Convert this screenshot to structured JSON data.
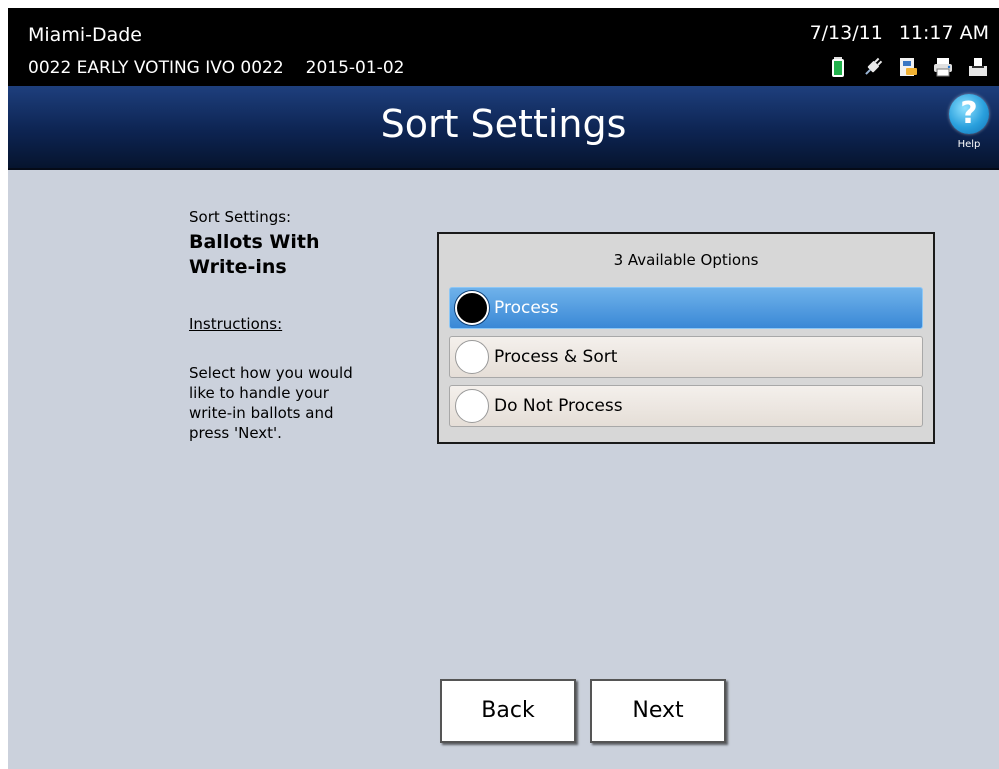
{
  "status": {
    "county": "Miami-Dade",
    "machine_id": "0022 EARLY VOTING IVO 0022",
    "election_date": "2015-01-02",
    "date": "7/13/11",
    "time": "11:17 AM",
    "icons": [
      "battery-icon",
      "power-plug-icon",
      "memory-card-icon",
      "printer-icon",
      "ballot-box-icon"
    ]
  },
  "header": {
    "title": "Sort Settings",
    "help_label": "Help",
    "help_glyph": "?"
  },
  "instructions": {
    "sort_label": "Sort Settings:",
    "setting_name_line1": "Ballots With",
    "setting_name_line2": "Write-ins",
    "instructions_label": "Instructions:",
    "text": "Select how you would like to handle your write-in ballots and press 'Next'."
  },
  "options": {
    "header": "3 Available Options",
    "items": [
      {
        "label": "Process",
        "selected": true
      },
      {
        "label": "Process & Sort",
        "selected": false
      },
      {
        "label": "Do Not Process",
        "selected": false
      }
    ]
  },
  "nav": {
    "back_label": "Back",
    "next_label": "Next"
  },
  "colors": {
    "background": "#cbd1dc",
    "title_bar": "#0d2452",
    "selected_option": "#4a96df",
    "help_button": "#2aa0dd"
  }
}
